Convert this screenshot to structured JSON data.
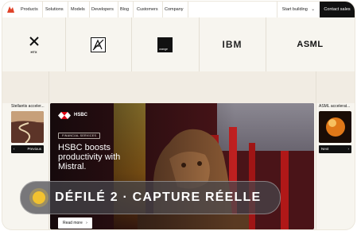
{
  "nav": {
    "items": [
      "Products",
      "Solutions",
      "Models",
      "Developers",
      "Blog",
      "Customers",
      "Company"
    ],
    "start_label": "Start building",
    "contact_label": "Contact sales"
  },
  "logos": {
    "htx": "HTX",
    "orange": "orange",
    "ibm": "IBM",
    "asml": "ASML"
  },
  "left_card": {
    "title": "Stellantis acceler...",
    "button": "Previous"
  },
  "right_card": {
    "title": "ASML accelerat...",
    "button": "Next"
  },
  "hero": {
    "brand": "HSBC",
    "tag": "FINANCIAL SERVICES",
    "headline": "HSBC boosts productivity with Mistral.",
    "cta": "Read more"
  },
  "overlay": {
    "text": "DÉFILÉ 2 · CAPTURE RÉELLE"
  },
  "colors": {
    "brand_orange": "#ff7000",
    "hsbc_red": "#db0011",
    "pill_accent": "#f2c230"
  }
}
